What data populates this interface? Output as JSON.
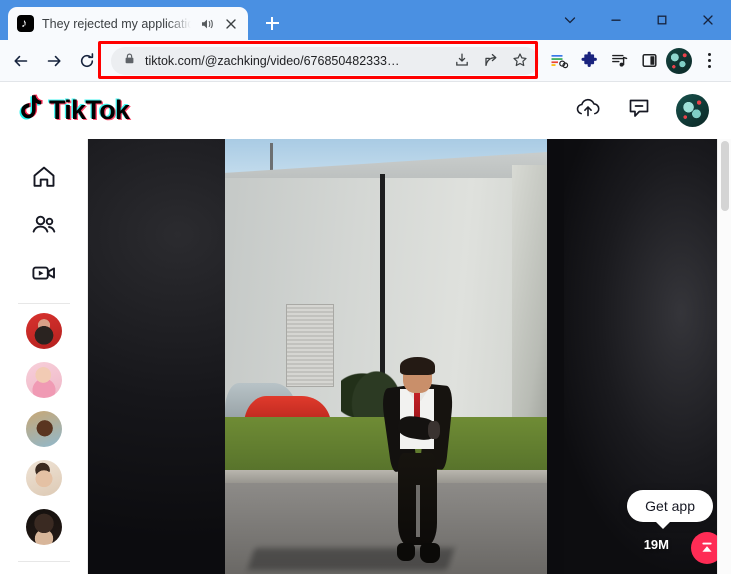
{
  "browser": {
    "tab": {
      "title": "They rejected my application",
      "favicon_icon": "tiktok-favicon",
      "audio_icon": "speaker-playing-icon",
      "close_icon": "close-icon"
    },
    "new_tab_icon": "plus-icon",
    "window_controls": {
      "tab_search_icon": "chevron-down-icon",
      "minimize_icon": "minimize-icon",
      "maximize_icon": "maximize-icon",
      "close_icon": "close-icon"
    },
    "nav": {
      "back_icon": "back-arrow-icon",
      "forward_icon": "forward-arrow-icon",
      "reload_icon": "reload-icon"
    },
    "omnibox": {
      "lock_icon": "lock-icon",
      "url": "tiktok.com/@zachking/video/676850482333…",
      "install_icon": "install-app-icon",
      "share_icon": "share-icon",
      "bookmark_icon": "star-icon"
    },
    "toolbar_icons": [
      {
        "name": "link-preview-icon"
      },
      {
        "name": "extensions-puzzle-icon"
      },
      {
        "name": "media-playlist-icon"
      },
      {
        "name": "side-panel-icon"
      },
      {
        "name": "profile-avatar-icon"
      },
      {
        "name": "kebab-menu-icon"
      }
    ],
    "highlight_color": "#ff0000"
  },
  "tiktok": {
    "logo_text": "TikTok",
    "logo_note_icon": "tiktok-note-icon",
    "header_actions": [
      {
        "name": "upload-icon"
      },
      {
        "name": "messages-icon"
      },
      {
        "name": "profile-avatar"
      }
    ],
    "sidebar": {
      "nav": [
        {
          "name": "sidebar-item-for-you",
          "icon": "home-icon"
        },
        {
          "name": "sidebar-item-following",
          "icon": "people-icon"
        },
        {
          "name": "sidebar-item-live",
          "icon": "live-video-icon"
        }
      ],
      "accounts": [
        {
          "name": "suggested-account-1"
        },
        {
          "name": "suggested-account-2"
        },
        {
          "name": "suggested-account-3"
        },
        {
          "name": "suggested-account-4"
        },
        {
          "name": "suggested-account-5"
        }
      ]
    },
    "video": {
      "get_app_label": "Get app",
      "view_count": "19M",
      "scroll_button_icon": "scroll-to-top-icon",
      "accent_color": "#fe2c55"
    }
  }
}
